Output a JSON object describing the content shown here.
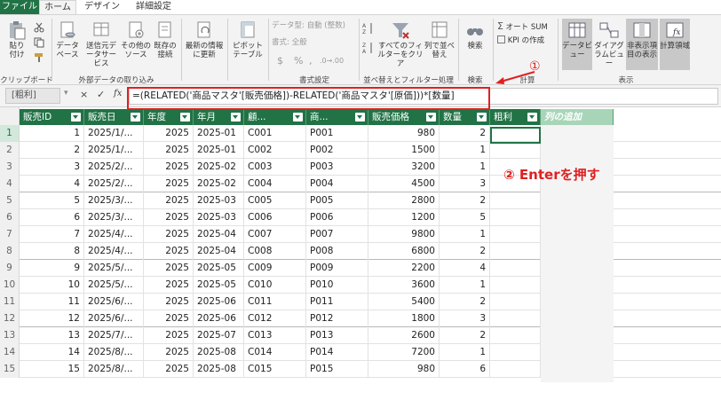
{
  "tabs": [
    "ファイル",
    "ホーム",
    "デザイン",
    "詳細設定"
  ],
  "ribbon": {
    "clipboard": {
      "paste": "貼り付け",
      "group": "クリップボード"
    },
    "external": {
      "data_base": "データベース",
      "data_service": "送信元データサービス",
      "other_source": "その他のソース",
      "existing": "既存の接続",
      "group": "外部データの取り込み"
    },
    "refresh": "最新の情報に更新",
    "pivot": "ピボットテーブル",
    "format": {
      "data_type": "データ型: 自動 (整数)",
      "format": "書式: 全般",
      "currency": "$",
      "percent": "%",
      "comma": ",",
      "group": "書式設定"
    },
    "sort": {
      "clear_filters": "すべてのフィルターをクリア",
      "sort_by_column": "列で並べ替え",
      "group": "並べ替えとフィルター処理"
    },
    "find": {
      "find": "検索",
      "group": "検索"
    },
    "calc": {
      "autosum": "オート SUM",
      "kpi": "KPI の作成",
      "group": "計算"
    },
    "view": {
      "data_view": "データビュー",
      "diagram_view": "ダイアグラムビュー",
      "show_hidden": "非表示項目の表示",
      "calc_area": "計算領域",
      "group": "表示"
    }
  },
  "formula_bar": {
    "name_box": "[粗利]",
    "cancel": "×",
    "confirm": "✓",
    "fx": "fx",
    "formula": "=(RELATED('商品マスタ'[販売価格])-RELATED('商品マスタ'[原価]))*[数量]"
  },
  "annotations": {
    "step1": "①",
    "step2": "② Enterを押す"
  },
  "table": {
    "columns": [
      "販売ID",
      "販売日",
      "年度",
      "年月",
      "顧...",
      "商...",
      "販売価格",
      "数量",
      "粗利",
      "列の追加"
    ],
    "rows": [
      [
        1,
        "2025/1/...",
        2025,
        "2025-01",
        "C001",
        "P001",
        980,
        2
      ],
      [
        2,
        "2025/1/...",
        2025,
        "2025-01",
        "C002",
        "P002",
        1500,
        1
      ],
      [
        3,
        "2025/2/...",
        2025,
        "2025-02",
        "C003",
        "P003",
        3200,
        1
      ],
      [
        4,
        "2025/2/...",
        2025,
        "2025-02",
        "C004",
        "P004",
        4500,
        3
      ],
      [
        5,
        "2025/3/...",
        2025,
        "2025-03",
        "C005",
        "P005",
        2800,
        2
      ],
      [
        6,
        "2025/3/...",
        2025,
        "2025-03",
        "C006",
        "P006",
        1200,
        5
      ],
      [
        7,
        "2025/4/...",
        2025,
        "2025-04",
        "C007",
        "P007",
        9800,
        1
      ],
      [
        8,
        "2025/4/...",
        2025,
        "2025-04",
        "C008",
        "P008",
        6800,
        2
      ],
      [
        9,
        "2025/5/...",
        2025,
        "2025-05",
        "C009",
        "P009",
        2200,
        4
      ],
      [
        10,
        "2025/5/...",
        2025,
        "2025-05",
        "C010",
        "P010",
        3600,
        1
      ],
      [
        11,
        "2025/6/...",
        2025,
        "2025-06",
        "C011",
        "P011",
        5400,
        2
      ],
      [
        12,
        "2025/6/...",
        2025,
        "2025-06",
        "C012",
        "P012",
        1800,
        3
      ],
      [
        13,
        "2025/7/...",
        2025,
        "2025-07",
        "C013",
        "P013",
        2600,
        2
      ],
      [
        14,
        "2025/8/...",
        2025,
        "2025-08",
        "C014",
        "P014",
        7200,
        1
      ],
      [
        15,
        "2025/8/...",
        2025,
        "2025-08",
        "C015",
        "P015",
        980,
        6
      ]
    ]
  }
}
